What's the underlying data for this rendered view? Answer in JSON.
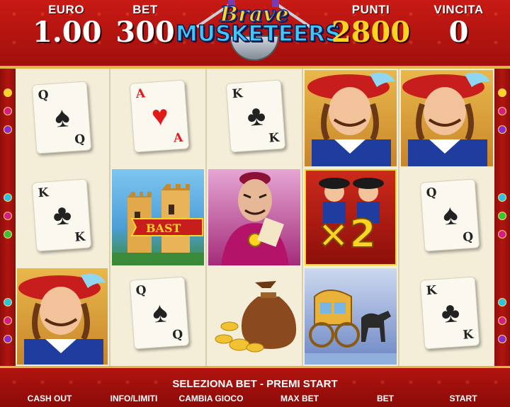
{
  "header": {
    "euro": {
      "label": "EURO",
      "value": "1.00"
    },
    "bet": {
      "label": "BET",
      "value": "300"
    },
    "punti": {
      "label": "PUNTI",
      "value": "2800"
    },
    "vincita": {
      "label": "VINCITA",
      "value": "0"
    },
    "logo": {
      "line1": "Brave",
      "line2": "MUSKETEERS"
    }
  },
  "reels": {
    "reel1": {
      "row1": {
        "symbol": "card",
        "rank": "Q",
        "suit": "♠"
      },
      "row2": {
        "symbol": "card",
        "rank": "K",
        "suit": "♣"
      },
      "row3": {
        "symbol": "musketeer-icon"
      }
    },
    "reel2": {
      "row1": {
        "symbol": "card",
        "rank": "A",
        "suit": "♥"
      },
      "row2": {
        "symbol": "castle-icon",
        "banner": "BAST"
      },
      "row3": {
        "symbol": "card",
        "rank": "Q",
        "suit": "♠"
      }
    },
    "reel3": {
      "row1": {
        "symbol": "card",
        "rank": "K",
        "suit": "♣"
      },
      "row2": {
        "symbol": "cardinal-icon"
      },
      "row3": {
        "symbol": "gold-bag-icon"
      }
    },
    "reel4": {
      "row1": {
        "symbol": "musketeer-icon"
      },
      "row2": {
        "symbol": "multiplier-icon",
        "multiplier": "×2"
      },
      "row3": {
        "symbol": "carriage-icon"
      }
    },
    "reel5": {
      "row1": {
        "symbol": "musketeer-icon"
      },
      "row2": {
        "symbol": "card",
        "rank": "Q",
        "suit": "♠"
      },
      "row3": {
        "symbol": "card",
        "rank": "K",
        "suit": "♣"
      }
    }
  },
  "footer": {
    "message": "SELEZIONA BET - PREMI START",
    "buttons": {
      "cash_out": "CASH OUT",
      "info": "INFO/LIMITI",
      "cambia": "CAMBIA GIOCO",
      "max_bet": "MAX BET",
      "bet": "BET",
      "start": "START"
    }
  },
  "colors": {
    "header_red": "#b8150f",
    "gold": "#ffd321",
    "logo_blue": "#42c6f4",
    "reel_bg": "#f4eed9"
  }
}
